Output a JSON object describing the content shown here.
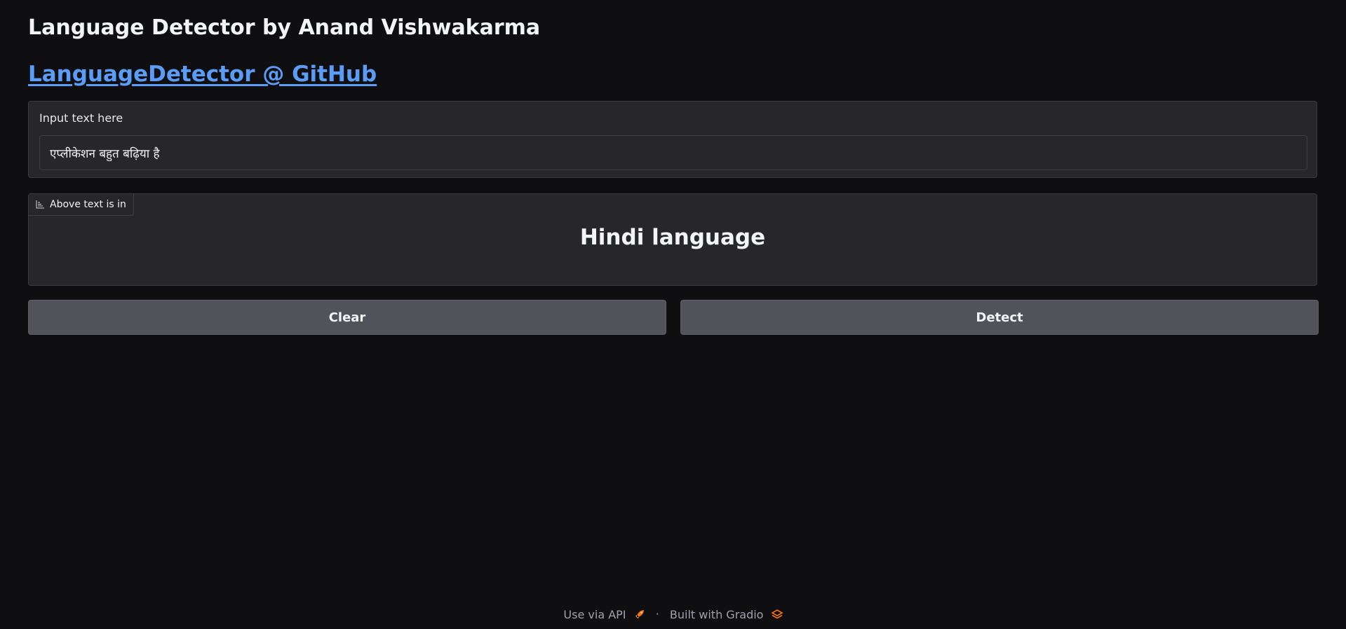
{
  "header": {
    "title": "Language Detector by Anand Vishwakarma",
    "link_text": "LanguageDetector @ GitHub"
  },
  "input": {
    "label": "Input text here",
    "value": "एप्लीकेशन बहुत बढ़िया है"
  },
  "output": {
    "label": "Above text is in",
    "value": "Hindi language",
    "icon": "label-icon"
  },
  "actions": {
    "clear_label": "Clear",
    "detect_label": "Detect"
  },
  "footer": {
    "api_label": "Use via API",
    "separator": "·",
    "built_with": "Built with Gradio",
    "icons": [
      "rocket-icon",
      "gradio-logo-icon"
    ]
  },
  "colors": {
    "background": "#0f0f11",
    "panel": "#27272a",
    "button": "#52525b",
    "link": "#5b9cf6",
    "accent": "#f97316"
  }
}
